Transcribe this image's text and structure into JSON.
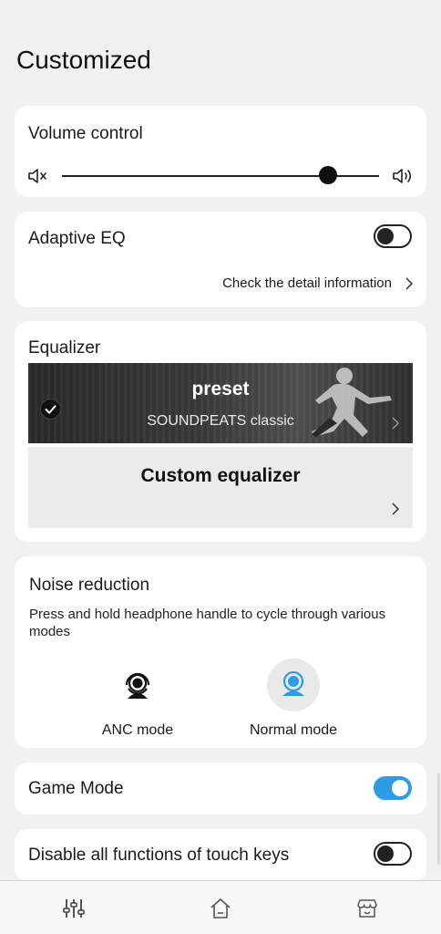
{
  "page": {
    "title": "Customized"
  },
  "volume": {
    "title": "Volume control",
    "level_fraction": 0.84,
    "mute_icon": "volume-mute-icon",
    "max_icon": "volume-up-icon"
  },
  "adaptive_eq": {
    "title": "Adaptive EQ",
    "enabled": false,
    "detail_link": "Check the detail information"
  },
  "equalizer": {
    "title": "Equalizer",
    "preset": {
      "label": "preset",
      "name": "SOUNDPEATS classic",
      "selected": true
    },
    "custom": {
      "label": "Custom equalizer"
    }
  },
  "noise": {
    "title": "Noise reduction",
    "description": "Press and hold headphone handle to cycle through various modes",
    "modes": [
      {
        "label": "ANC mode",
        "icon": "anc-mode-icon",
        "selected": false
      },
      {
        "label": "Normal mode",
        "icon": "normal-mode-icon",
        "selected": true
      }
    ]
  },
  "game_mode": {
    "title": "Game Mode",
    "enabled": true
  },
  "touch_keys": {
    "title": "Disable all functions of touch keys",
    "enabled": false
  },
  "nav": {
    "items": [
      {
        "icon": "equalizer-sliders-icon"
      },
      {
        "icon": "home-icon"
      },
      {
        "icon": "store-icon"
      }
    ]
  },
  "colors": {
    "accent": "#2d9be6",
    "background": "#f1f1f1",
    "card": "#ffffff"
  }
}
